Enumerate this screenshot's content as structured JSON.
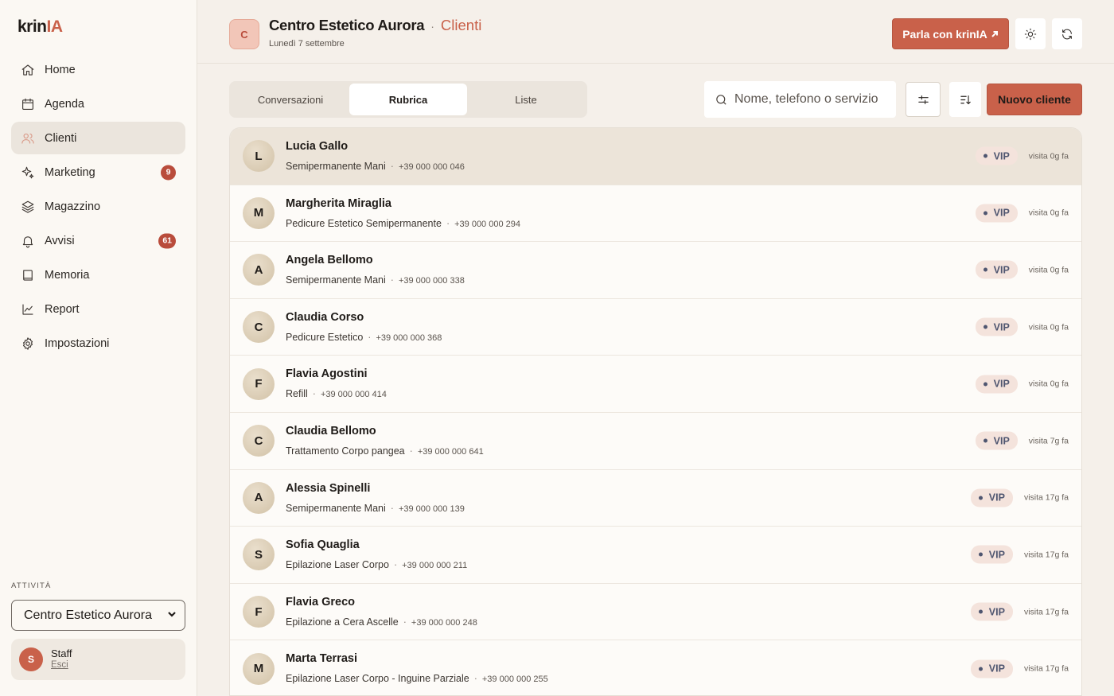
{
  "brand": {
    "logo_main": "krin",
    "logo_accent": "IA"
  },
  "nav": [
    {
      "label": "Home",
      "icon": "home-icon",
      "badge": ""
    },
    {
      "label": "Agenda",
      "icon": "calendar-icon",
      "badge": ""
    },
    {
      "label": "Clienti",
      "icon": "users-icon",
      "badge": "",
      "active": true
    },
    {
      "label": "Marketing",
      "icon": "sparkles-icon",
      "badge": "9"
    },
    {
      "label": "Magazzino",
      "icon": "layers-icon",
      "badge": ""
    },
    {
      "label": "Avvisi",
      "icon": "bell-icon",
      "badge": "61"
    },
    {
      "label": "Memoria",
      "icon": "book-icon",
      "badge": ""
    },
    {
      "label": "Report",
      "icon": "chart-line-icon",
      "badge": ""
    },
    {
      "label": "Impostazioni",
      "icon": "gear-icon",
      "badge": ""
    }
  ],
  "activity": {
    "label": "ATTIVITÀ",
    "selected": "Centro Estetico Aurora"
  },
  "user": {
    "initial": "S",
    "name": "Staff",
    "logout": "Esci"
  },
  "header": {
    "avatar_initial": "C",
    "business_name": "Centro Estetico Aurora",
    "separator": "·",
    "section": "Clienti",
    "date": "Lunedì 7 settembre",
    "chat_button": "Parla con krinIA"
  },
  "tabs": [
    {
      "label": "Conversazioni",
      "active": false
    },
    {
      "label": "Rubrica",
      "active": true
    },
    {
      "label": "Liste",
      "active": false
    }
  ],
  "search": {
    "placeholder": "Nome, telefono o servizio",
    "value": ""
  },
  "new_client_button": "Nuovo cliente",
  "clients": [
    {
      "initial": "L",
      "name": "Lucia Gallo",
      "service": "Semipermanente Mani",
      "phone": "+39 000 000 046",
      "badge": "VIP",
      "visit": "visita 0g fa",
      "selected": true
    },
    {
      "initial": "M",
      "name": "Margherita Miraglia",
      "service": "Pedicure Estetico Semipermanente",
      "phone": "+39 000 000 294",
      "badge": "VIP",
      "visit": "visita 0g fa"
    },
    {
      "initial": "A",
      "name": "Angela Bellomo",
      "service": "Semipermanente Mani",
      "phone": "+39 000 000 338",
      "badge": "VIP",
      "visit": "visita 0g fa"
    },
    {
      "initial": "C",
      "name": "Claudia Corso",
      "service": "Pedicure Estetico",
      "phone": "+39 000 000 368",
      "badge": "VIP",
      "visit": "visita 0g fa"
    },
    {
      "initial": "F",
      "name": "Flavia Agostini",
      "service": "Refill",
      "phone": "+39 000 000 414",
      "badge": "VIP",
      "visit": "visita 0g fa"
    },
    {
      "initial": "C",
      "name": "Claudia Bellomo",
      "service": "Trattamento Corpo pangea",
      "phone": "+39 000 000 641",
      "badge": "VIP",
      "visit": "visita 7g fa"
    },
    {
      "initial": "A",
      "name": "Alessia Spinelli",
      "service": "Semipermanente Mani",
      "phone": "+39 000 000 139",
      "badge": "VIP",
      "visit": "visita 17g fa"
    },
    {
      "initial": "S",
      "name": "Sofia Quaglia",
      "service": "Epilazione Laser Corpo",
      "phone": "+39 000 000 211",
      "badge": "VIP",
      "visit": "visita 17g fa"
    },
    {
      "initial": "F",
      "name": "Flavia Greco",
      "service": "Epilazione a Cera Ascelle",
      "phone": "+39 000 000 248",
      "badge": "VIP",
      "visit": "visita 17g fa"
    },
    {
      "initial": "M",
      "name": "Marta Terrasi",
      "service": "Epilazione Laser Corpo - Inguine Parziale",
      "phone": "+39 000 000 255",
      "badge": "VIP",
      "visit": "visita 17g fa"
    }
  ],
  "colors": {
    "accent": "#c9614a",
    "badge": "#b94c3b",
    "background": "#f5f0ea",
    "selected_row": "#ece4d9"
  }
}
